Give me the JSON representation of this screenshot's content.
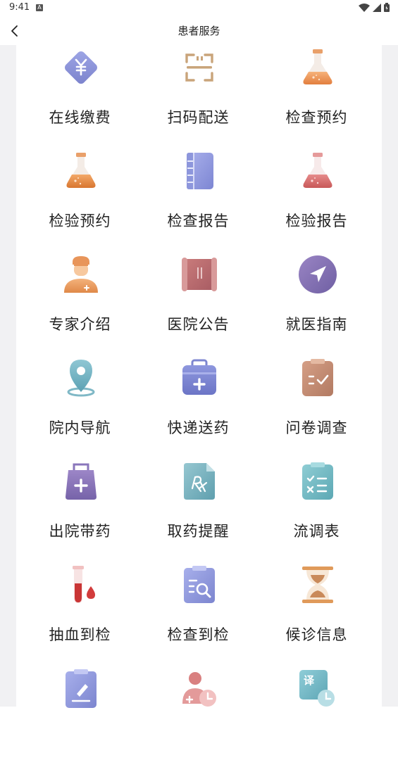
{
  "status_bar": {
    "time": "9:41",
    "notification_glyph": "A"
  },
  "header": {
    "title": "患者服务"
  },
  "services": [
    {
      "label": "在线缴费",
      "icon": "yuan-payment-icon"
    },
    {
      "label": "扫码配送",
      "icon": "scan-code-icon"
    },
    {
      "label": "检查预约",
      "icon": "flask-icon"
    },
    {
      "label": "检验预约",
      "icon": "flask-icon"
    },
    {
      "label": "检查报告",
      "icon": "notebook-icon"
    },
    {
      "label": "检验报告",
      "icon": "flask-red-icon"
    },
    {
      "label": "专家介绍",
      "icon": "doctor-icon"
    },
    {
      "label": "医院公告",
      "icon": "scroll-icon"
    },
    {
      "label": "就医指南",
      "icon": "navigation-arrow-icon"
    },
    {
      "label": "院内导航",
      "icon": "location-pin-icon"
    },
    {
      "label": "快递送药",
      "icon": "medical-kit-icon"
    },
    {
      "label": "问卷调查",
      "icon": "checklist-clipboard-icon"
    },
    {
      "label": "出院带药",
      "icon": "medicine-bag-icon"
    },
    {
      "label": "取药提醒",
      "icon": "prescription-rx-icon"
    },
    {
      "label": "流调表",
      "icon": "survey-clipboard-icon"
    },
    {
      "label": "抽血到检",
      "icon": "blood-tube-icon"
    },
    {
      "label": "检查到检",
      "icon": "clipboard-search-icon"
    },
    {
      "label": "候诊信息",
      "icon": "hourglass-icon"
    },
    {
      "label": "",
      "icon": "edit-clipboard-icon"
    },
    {
      "label": "",
      "icon": "person-clock-icon"
    },
    {
      "label": "译",
      "icon": "translate-clock-icon"
    }
  ]
}
